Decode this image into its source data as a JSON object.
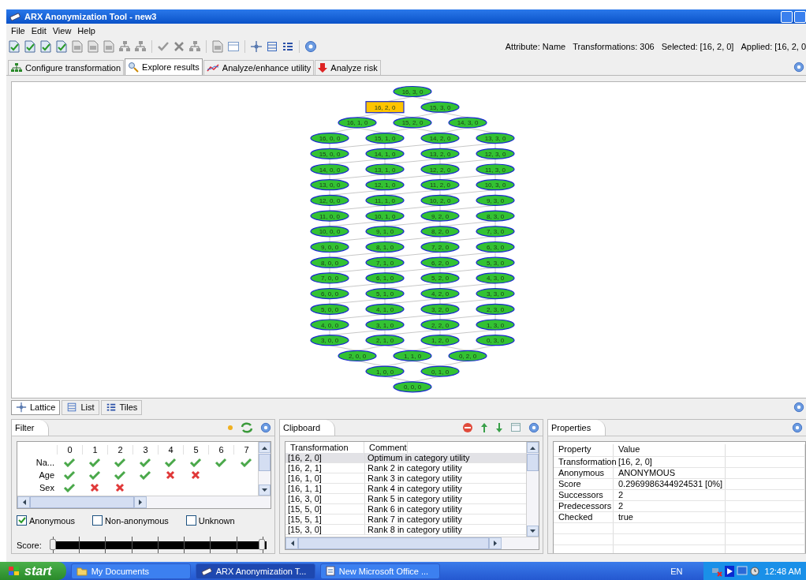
{
  "window": {
    "title": "ARX Anonymization Tool - new3"
  },
  "menu": [
    "File",
    "Edit",
    "View",
    "Help"
  ],
  "status": [
    "Attribute: Name",
    "Transformations: 306",
    "Selected: [16, 2, 0]",
    "Applied: [16, 2, 0"
  ],
  "tabs": [
    {
      "label": "Configure transformation",
      "selected": false,
      "kind": "tree"
    },
    {
      "label": "Explore results",
      "selected": true,
      "kind": "search"
    },
    {
      "label": "Analyze/enhance utility",
      "selected": false,
      "kind": "chart"
    },
    {
      "label": "Analyze risk",
      "selected": false,
      "kind": "risk"
    }
  ],
  "lattice": {
    "rows": [
      [
        {
          "label": "16, 3, 0",
          "selected": false
        }
      ],
      [
        {
          "label": "16, 2, 0",
          "selected": true
        },
        {
          "label": "15, 3, 0",
          "selected": false
        }
      ],
      [
        {
          "label": "16, 1, 0",
          "selected": false
        },
        {
          "label": "15, 2, 0",
          "selected": false
        },
        {
          "label": "14, 3, 0",
          "selected": false
        }
      ],
      [
        {
          "label": "16, 0, 0",
          "selected": false
        },
        {
          "label": "15, 1, 0",
          "selected": false
        },
        {
          "label": "14, 2, 0",
          "selected": false
        },
        {
          "label": "13, 3, 0",
          "selected": false
        }
      ],
      [
        {
          "label": "15, 0, 0",
          "selected": false
        },
        {
          "label": "14, 1, 0",
          "selected": false
        },
        {
          "label": "13, 2, 0",
          "selected": false
        },
        {
          "label": "12, 3, 0",
          "selected": false
        }
      ],
      [
        {
          "label": "14, 0, 0",
          "selected": false
        },
        {
          "label": "13, 1, 0",
          "selected": false
        },
        {
          "label": "12, 2, 0",
          "selected": false
        },
        {
          "label": "11, 3, 0",
          "selected": false
        }
      ],
      [
        {
          "label": "13, 0, 0",
          "selected": false
        },
        {
          "label": "12, 1, 0",
          "selected": false
        },
        {
          "label": "11, 2, 0",
          "selected": false
        },
        {
          "label": "10, 3, 0",
          "selected": false
        }
      ],
      [
        {
          "label": "12, 0, 0",
          "selected": false
        },
        {
          "label": "11, 1, 0",
          "selected": false
        },
        {
          "label": "10, 2, 0",
          "selected": false
        },
        {
          "label": "9, 3, 0",
          "selected": false
        }
      ],
      [
        {
          "label": "11, 0, 0",
          "selected": false
        },
        {
          "label": "10, 1, 0",
          "selected": false
        },
        {
          "label": "9, 2, 0",
          "selected": false
        },
        {
          "label": "8, 3, 0",
          "selected": false
        }
      ],
      [
        {
          "label": "10, 0, 0",
          "selected": false
        },
        {
          "label": "9, 1, 0",
          "selected": false
        },
        {
          "label": "8, 2, 0",
          "selected": false
        },
        {
          "label": "7, 3, 0",
          "selected": false
        }
      ],
      [
        {
          "label": "9, 0, 0",
          "selected": false
        },
        {
          "label": "8, 1, 0",
          "selected": false
        },
        {
          "label": "7, 2, 0",
          "selected": false
        },
        {
          "label": "6, 3, 0",
          "selected": false
        }
      ],
      [
        {
          "label": "8, 0, 0",
          "selected": false
        },
        {
          "label": "7, 1, 0",
          "selected": false
        },
        {
          "label": "6, 2, 0",
          "selected": false
        },
        {
          "label": "5, 3, 0",
          "selected": false
        }
      ],
      [
        {
          "label": "7, 0, 0",
          "selected": false
        },
        {
          "label": "6, 1, 0",
          "selected": false
        },
        {
          "label": "5, 2, 0",
          "selected": false
        },
        {
          "label": "4, 3, 0",
          "selected": false
        }
      ],
      [
        {
          "label": "6, 0, 0",
          "selected": false
        },
        {
          "label": "5, 1, 0",
          "selected": false
        },
        {
          "label": "4, 2, 0",
          "selected": false
        },
        {
          "label": "3, 3, 0",
          "selected": false
        }
      ],
      [
        {
          "label": "5, 0, 0",
          "selected": false
        },
        {
          "label": "4, 1, 0",
          "selected": false
        },
        {
          "label": "3, 2, 0",
          "selected": false
        },
        {
          "label": "2, 3, 0",
          "selected": false
        }
      ],
      [
        {
          "label": "4, 0, 0",
          "selected": false
        },
        {
          "label": "3, 1, 0",
          "selected": false
        },
        {
          "label": "2, 2, 0",
          "selected": false
        },
        {
          "label": "1, 3, 0",
          "selected": false
        }
      ],
      [
        {
          "label": "3, 0, 0",
          "selected": false
        },
        {
          "label": "2, 1, 0",
          "selected": false
        },
        {
          "label": "1, 2, 0",
          "selected": false
        },
        {
          "label": "0, 3, 0",
          "selected": false
        }
      ],
      [
        {
          "label": "2, 0, 0",
          "selected": false
        },
        {
          "label": "1, 1, 0",
          "selected": false
        },
        {
          "label": "0, 2, 0",
          "selected": false
        }
      ],
      [
        {
          "label": "1, 0, 0",
          "selected": false
        },
        {
          "label": "0, 1, 0",
          "selected": false
        }
      ],
      [
        {
          "label": "0, 0, 0",
          "selected": false
        }
      ]
    ]
  },
  "view_tabs": [
    {
      "label": "Lattice",
      "selected": true,
      "kind": "lattice"
    },
    {
      "label": "List",
      "selected": false,
      "kind": "list"
    },
    {
      "label": "Tiles",
      "selected": false,
      "kind": "tiles"
    }
  ],
  "filter": {
    "title": "Filter",
    "columns": [
      "0",
      "1",
      "2",
      "3",
      "4",
      "5",
      "6",
      "7"
    ],
    "rows": [
      {
        "label": "Na...",
        "cells": [
          {
            "kind": "check"
          },
          {
            "kind": "check"
          },
          {
            "kind": "check"
          },
          {
            "kind": "check"
          },
          {
            "kind": "check"
          },
          {
            "kind": "check"
          },
          {
            "kind": "check"
          },
          {
            "kind": "check"
          }
        ]
      },
      {
        "label": "Age",
        "cells": [
          {
            "kind": "check"
          },
          {
            "kind": "check"
          },
          {
            "kind": "check"
          },
          {
            "kind": "check"
          },
          {
            "kind": "cross"
          },
          {
            "kind": "cross"
          }
        ]
      },
      {
        "label": "Sex",
        "cells": [
          {
            "kind": "check"
          },
          {
            "kind": "cross"
          },
          {
            "kind": "cross"
          }
        ]
      }
    ],
    "checkboxes": [
      {
        "label": "Anonymous",
        "checked": true
      },
      {
        "label": "Non-anonymous",
        "checked": false
      },
      {
        "label": "Unknown",
        "checked": false
      }
    ],
    "score": {
      "label": "Score:",
      "thumbs": [
        {
          "level": 0
        },
        {
          "level": 1
        }
      ]
    }
  },
  "clipboard": {
    "title": "Clipboard",
    "columns": [
      "Transformation",
      "Comment"
    ],
    "rows": [
      {
        "cells": [
          "[16, 2, 0]",
          "Optimum in category utility"
        ],
        "selected": true
      },
      {
        "cells": [
          "[16, 2, 1]",
          "Rank 2 in category utility"
        ],
        "selected": false
      },
      {
        "cells": [
          "[16, 1, 0]",
          "Rank 3 in category utility"
        ],
        "selected": false
      },
      {
        "cells": [
          "[16, 1, 1]",
          "Rank 4 in category utility"
        ],
        "selected": false
      },
      {
        "cells": [
          "[16, 3, 0]",
          "Rank 5 in category utility"
        ],
        "selected": false
      },
      {
        "cells": [
          "[15, 5, 0]",
          "Rank 6 in category utility"
        ],
        "selected": false
      },
      {
        "cells": [
          "[15, 5, 1]",
          "Rank 7 in category utility"
        ],
        "selected": false
      },
      {
        "cells": [
          "[15, 3, 0]",
          "Rank 8 in category utility"
        ],
        "selected": false
      }
    ]
  },
  "properties": {
    "title": "Properties",
    "columns": [
      "Property",
      "Value"
    ],
    "rows": [
      [
        "Transformation",
        "[16, 2, 0]"
      ],
      [
        "Anonymous",
        "ANONYMOUS"
      ],
      [
        "Score",
        "0.2969986344924531 [0%]"
      ],
      [
        "Successors",
        "2"
      ],
      [
        "Predecessors",
        "2"
      ],
      [
        "Checked",
        "true"
      ]
    ]
  },
  "taskbar": {
    "start": "start",
    "items": [
      {
        "label": "My Documents",
        "selected": false,
        "kind": "folder"
      },
      {
        "label": "ARX Anonymization T...",
        "selected": true,
        "kind": "app"
      },
      {
        "label": "New Microsoft Office ...",
        "selected": false,
        "kind": "doc"
      }
    ],
    "language": "EN",
    "clock": "12:48 AM"
  }
}
